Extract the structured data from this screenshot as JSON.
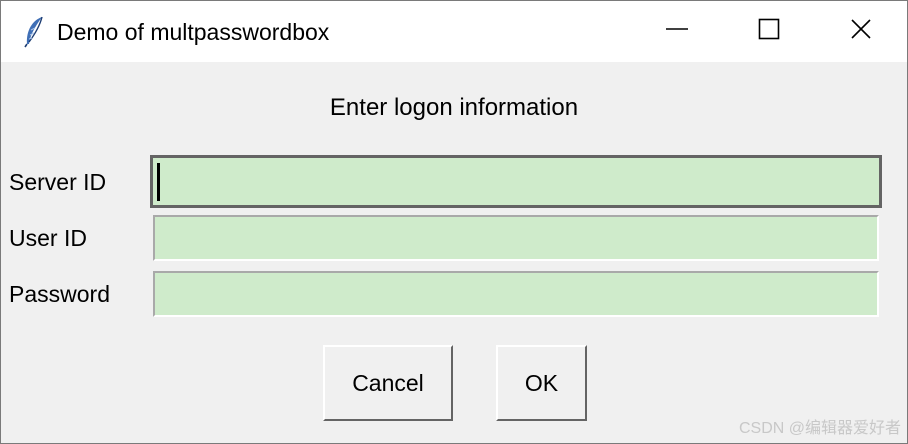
{
  "window": {
    "title": "Demo of multpasswordbox",
    "icon": "feather-icon"
  },
  "titlebar_buttons": {
    "minimize": "minimize-icon",
    "maximize": "maximize-icon",
    "close": "close-icon"
  },
  "prompt": "Enter logon information",
  "fields": [
    {
      "label": "Server ID",
      "value": ""
    },
    {
      "label": "User ID",
      "value": ""
    },
    {
      "label": "Password",
      "value": ""
    }
  ],
  "buttons": {
    "cancel": "Cancel",
    "ok": "OK"
  },
  "watermark": "CSDN @编辑器爱好者",
  "colors": {
    "field_background": "#cfebcb",
    "dialog_background": "#f0f0f0",
    "titlebar_background": "#ffffff"
  }
}
